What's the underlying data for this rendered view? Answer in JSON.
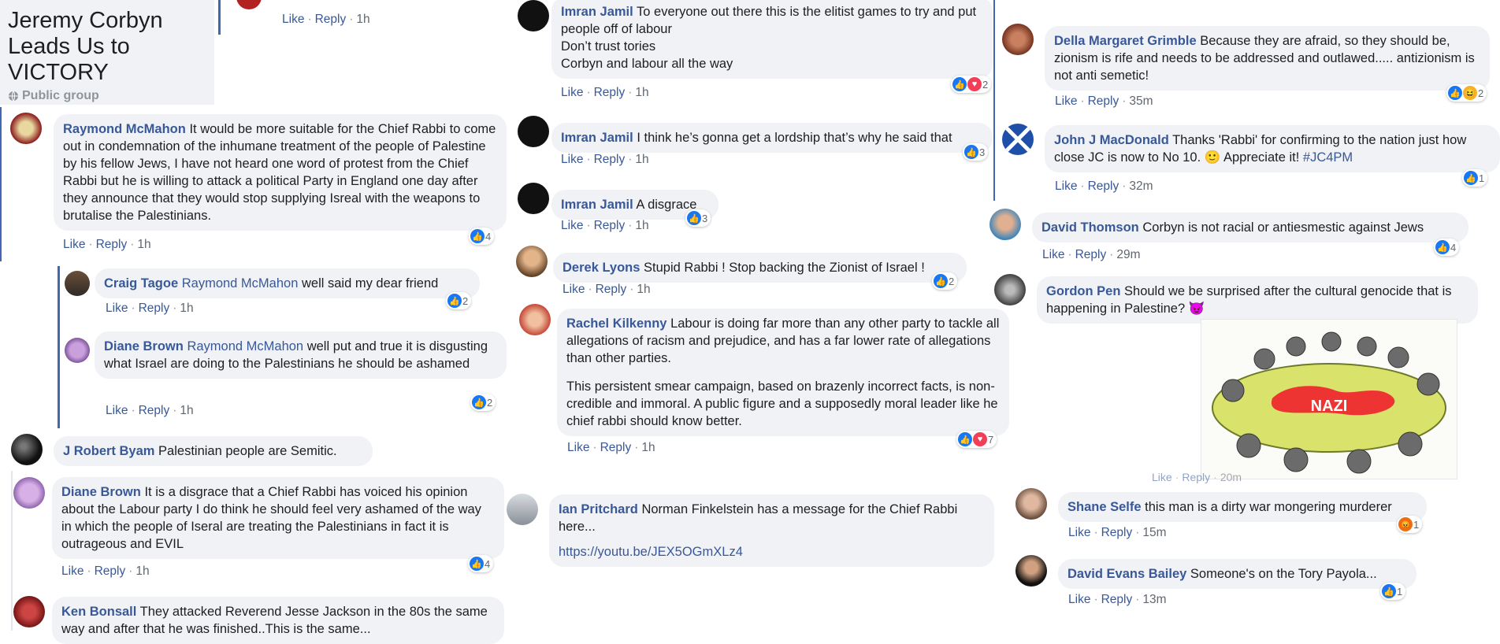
{
  "group": {
    "title_lines": [
      "Jeremy Corbyn",
      "Leads Us to",
      "VICTORY"
    ],
    "privacy": "Public group"
  },
  "actions": {
    "like": "Like",
    "reply": "Reply"
  },
  "top_left_stub": {
    "time": "1h"
  },
  "comments": {
    "raymond": {
      "author": "Raymond McMahon",
      "text": "It would be more suitable for the Chief Rabbi to come out in condemnation of the inhumane treatment of the people of Palestine by his fellow Jews, I have not heard one word of protest from the Chief Rabbi but he is willing to attack a political Party in England one day after they announce that they would stop supplying Isreal with the weapons to brutalise the Palestinians.",
      "time": "1h",
      "reactions": "4"
    },
    "craig": {
      "author": "Craig Tagoe",
      "mention": "Raymond McMahon",
      "text": "well said my dear friend",
      "time": "1h",
      "reactions": "2"
    },
    "diane1": {
      "author": "Diane Brown",
      "mention": "Raymond McMahon",
      "text": "well put and true it is disgusting what Israel are doing to the Palestinians he should be ashamed",
      "time": "1h",
      "reactions": "2"
    },
    "jrobert": {
      "author": "J Robert Byam",
      "text": "Palestinian people are Semitic."
    },
    "diane2": {
      "author": "Diane Brown",
      "text": "It is a disgrace that a Chief Rabbi has voiced his opinion about the Labour party I do think he should feel very ashamed of the way in which the people of Iseral are treating the Palestinians in fact it is outrageous and EVIL",
      "time": "1h",
      "reactions": "4"
    },
    "ken": {
      "author": "Ken Bonsall",
      "text": "They attacked Reverend Jesse Jackson in the 80s the same way and after that he was finished..This is the same..."
    },
    "imran1": {
      "author": "Imran Jamil",
      "text": "To everyone out there this is the elitist games to try and put people off of labour",
      "line2": "Don’t trust tories",
      "line3": "Corbyn and labour all the way",
      "time": "1h",
      "reactions": "2"
    },
    "imran2": {
      "author": "Imran Jamil",
      "text": "I think he’s gonna get a lordship that’s why he said that",
      "time": "1h",
      "reactions": "3"
    },
    "imran3": {
      "author": "Imran Jamil",
      "text": "A disgrace",
      "time": "1h",
      "reactions": "3"
    },
    "derek": {
      "author": "Derek Lyons",
      "text": "Stupid Rabbi ! Stop backing the Zionist of Israel !",
      "time": "1h",
      "reactions": "2"
    },
    "rachel": {
      "author": "Rachel Kilkenny",
      "text": "Labour is doing far more than any other party to tackle all allegations of racism and prejudice, and has a far lower rate of allegations than other parties.",
      "para2": "This persistent smear campaign, based on brazenly incorrect facts, is non-credible and immoral. A public figure and a supposedly moral leader like he chief rabbi should know better.",
      "time": "1h",
      "reactions": "7"
    },
    "ian": {
      "author": "Ian Pritchard",
      "text": "Norman Finkelstein has a message for the Chief Rabbi here...",
      "link": "https://youtu.be/JEX5OGmXLz4"
    },
    "della": {
      "author": "Della Margaret Grimble",
      "text": "Because they are afraid, so they should be, zionism is rife and needs to be addressed and outlawed..... antizionism is not anti semetic!",
      "time": "35m",
      "reactions": "2"
    },
    "johnj": {
      "author": "John J MacDonald",
      "text": "Thanks 'Rabbi' for confirming to the nation just how close JC is now to No 10.",
      "emoji": "🙂",
      "text2": "Appreciate it!",
      "hashtag": "#JC4PM",
      "time": "32m",
      "reactions": "1"
    },
    "davidt": {
      "author": "David Thomson",
      "text": "Corbyn is not racial or antiesmestic against Jews",
      "time": "29m",
      "reactions": "4"
    },
    "gordon": {
      "author": "Gordon Pen",
      "text": "Should we be surprised after the cultural genocide that is happening in Palestine?",
      "emoji": "😈",
      "time": "20m"
    },
    "shane": {
      "author": "Shane Selfe",
      "text": "this man is a dirty war mongering murderer",
      "time": "15m",
      "reactions": "1"
    },
    "davide": {
      "author": "David Evans Bailey",
      "text": "Someone's on the Tory Payola...",
      "time": "13m",
      "reactions": "1"
    }
  },
  "meme": {
    "label": "NAZI"
  },
  "colors": {
    "link": "#385898",
    "bubble": "#f0f2f5",
    "thread": "#4267b2",
    "like": "#1877f2",
    "love": "#f33e58"
  }
}
